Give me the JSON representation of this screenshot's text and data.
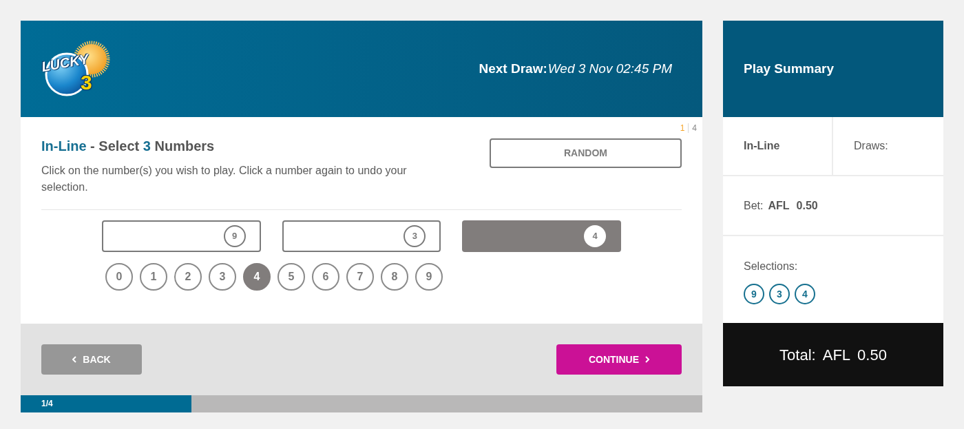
{
  "header": {
    "logo": {
      "word": "LUCKY",
      "number": "3"
    },
    "next_draw": {
      "label": "Next Draw:",
      "value": "Wed 3 Nov 02:45 PM"
    }
  },
  "step_indicator": {
    "current": "1",
    "total": "4"
  },
  "selection": {
    "title": [
      {
        "text": "In-Line",
        "highlight": true
      },
      {
        "text": "- Select",
        "highlight": false
      },
      {
        "text": "3",
        "highlight": true
      },
      {
        "text": "Numbers",
        "highlight": false
      }
    ],
    "instructions": "Click on the number(s) you wish to play. Click a number again to undo your selection.",
    "random_button": "RANDOM",
    "slots": [
      {
        "number": "9",
        "selected": false
      },
      {
        "number": "3",
        "selected": false
      },
      {
        "number": "4",
        "selected": true
      }
    ],
    "numbers": [
      {
        "label": "0",
        "selected": false
      },
      {
        "label": "1",
        "selected": false
      },
      {
        "label": "2",
        "selected": false
      },
      {
        "label": "3",
        "selected": false
      },
      {
        "label": "4",
        "selected": true
      },
      {
        "label": "5",
        "selected": false
      },
      {
        "label": "6",
        "selected": false
      },
      {
        "label": "7",
        "selected": false
      },
      {
        "label": "8",
        "selected": false
      },
      {
        "label": "9",
        "selected": false
      }
    ]
  },
  "footer": {
    "back_button": "BACK",
    "continue_button": "CONTINUE"
  },
  "progress": {
    "label": "1/4",
    "level": 0.25
  },
  "play_summary": {
    "title": "Play Summary",
    "game": "In-Line",
    "draws_label": "Draws:",
    "bet_label": "Bet:",
    "bet_currency": "AFL",
    "bet_amount": "0.50",
    "selections_label": "Selections:",
    "selections": [
      "9",
      "3",
      "4"
    ],
    "total_label": "Total:",
    "total_currency": "AFL",
    "total_amount": "0.50"
  }
}
